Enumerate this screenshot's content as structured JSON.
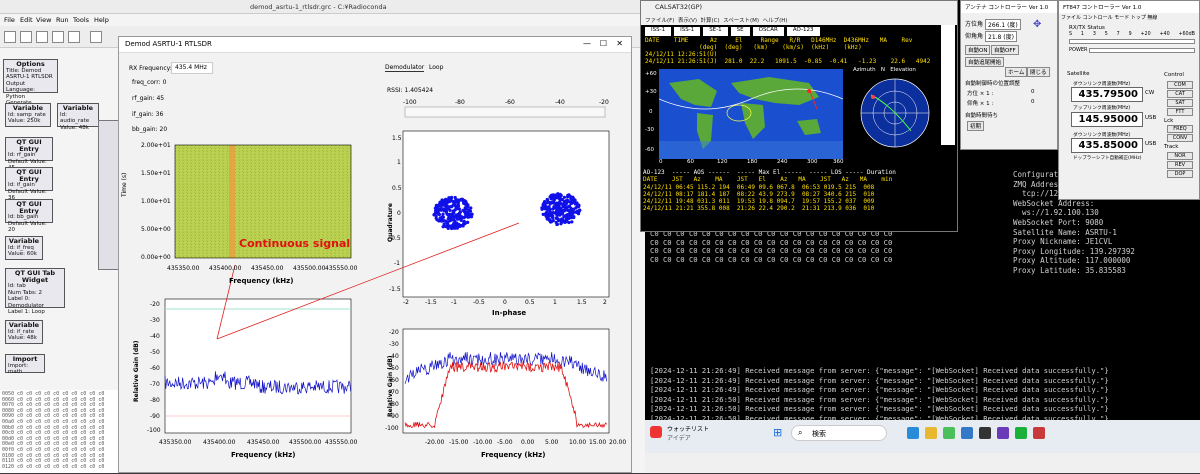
{
  "grc": {
    "title": "demod_asrtu-1_rtlsdr.grc - C:¥Radioconda",
    "menu": [
      "File",
      "Edit",
      "View",
      "Run",
      "Tools",
      "Help"
    ],
    "blocks": {
      "options": {
        "title": "Options",
        "lines": [
          "Title: Demod ASRTU-1 RTLSDR",
          "Output Language: Python",
          "Generate Options: QT GUI"
        ]
      },
      "var_samp": {
        "title": "Variable",
        "lines": [
          "Id: samp_rate",
          "Value: 250k"
        ]
      },
      "var_audio": {
        "title": "Variable",
        "lines": [
          "Id: audio_rate",
          "Value: 48k"
        ]
      },
      "rf_gain": {
        "title": "QT GUI Entry",
        "lines": [
          "Id: rf_gain",
          "Default Value: 45"
        ]
      },
      "if_gain": {
        "title": "QT GUI Entry",
        "lines": [
          "Id: if_gain",
          "Default Value: 36"
        ]
      },
      "bb_gain": {
        "title": "QT GUI Entry",
        "lines": [
          "Id: bb_gain",
          "Default Value: 20"
        ]
      },
      "var_freq": {
        "title": "Variable",
        "lines": [
          "Id: if_freq",
          "Value: 60k"
        ]
      },
      "tab_widget": {
        "title": "QT GUI Tab Widget",
        "lines": [
          "Id: tab",
          "Num Tabs: 2",
          "Label 0: Demodulator",
          "Label 1: Loop"
        ]
      },
      "var_rate": {
        "title": "Variable",
        "lines": [
          "Id: if_rate",
          "Value: 48k"
        ]
      },
      "import": {
        "title": "Import",
        "lines": [
          "Import: math"
        ]
      }
    },
    "console_lines": [
      "0050 c0 c0 c0 c0 c0 c0 c0 c0 c0 c0",
      "0060 c0 c0 c0 c0 c0 c0 c0 c0 c0 c0",
      "0070 c0 c0 c0 c0 c0 c0 c0 c0 c0 c0",
      "0080 c0 c0 c0 c0 c0 c0 c0 c0 c0 c0",
      "0090 c0 c0 c0 c0 c0 c0 c0 c0 c0 c0",
      "00a0 c0 c0 c0 c0 c0 c0 c0 c0 c0 c0",
      "00b0 c0 c0 c0 c0 c0 c0 c0 c0 c0 c0",
      "00c0 c0 c0 c0 c0 c0 c0 c0 c0 c0 c0",
      "00d0 c0 c0 c0 c0 c0 c0 c0 c0 c0 c0",
      "00e0 c0 c0 c0 c0 c0 c0 c0 c0 c0 c0",
      "00f0 c0 c0 c0 c0 c0 c0 c0 c0 c0 c0",
      "0100 c0 c0 c0 c0 c0 c0 c0 c0 c0 c0",
      "0110 c0 c0 c0 c0 c0 c0 c0 c0 c0 c0",
      "0120 c0 c0 c0 c0 c0 c0 c0 c0 c0 c0"
    ]
  },
  "demod": {
    "title": "Demod ASRTU-1 RTLSDR",
    "rx_freq_label": "RX Frequency:",
    "rx_freq_value": "435.4 MHz",
    "params": [
      "freq_corr: 0",
      "rf_gain: 45",
      "if_gain: 36",
      "bb_gain: 20"
    ],
    "tabs": [
      "Demodulator",
      "Loop"
    ],
    "rssi": "RSSI: 1.405424",
    "annotation": "Continuous signal",
    "waterfall": {
      "ylabel": "Time (s)",
      "xlabel": "Frequency (kHz)",
      "yticks": [
        "2.00e+01",
        "1.50e+01",
        "1.00e+01",
        "5.00e+00",
        "0.00e+00"
      ],
      "xticks": [
        "435350.00",
        "435400.00",
        "435450.00",
        "435500.00",
        "435550.00"
      ]
    },
    "spectrum": {
      "ylabel": "Relative Gain (dB)",
      "xlabel": "Frequency (kHz)",
      "yticks": [
        "-20",
        "-30",
        "-40",
        "-50",
        "-60",
        "-70",
        "-80",
        "-90",
        "-100"
      ],
      "xticks": [
        "435350.00",
        "435400.00",
        "435450.00",
        "435500.00",
        "435550.00"
      ]
    },
    "rssi_bar": {
      "ticks": [
        "-100",
        "-80",
        "-60",
        "-40",
        "-20"
      ]
    },
    "constellation": {
      "ylabel": "Quadrature",
      "xlabel": "In-phase",
      "yticks": [
        "1.5",
        "1",
        "0.5",
        "0",
        "-0.5",
        "-1",
        "-1.5"
      ],
      "xticks": [
        "-2",
        "-1.5",
        "-1",
        "-0.5",
        "0",
        "0.5",
        "1",
        "1.5",
        "2"
      ]
    },
    "demod_spec": {
      "ylabel": "Relative Gain (dB)",
      "xlabel": "Frequency (kHz)",
      "yticks": [
        "-20",
        "-30",
        "-40",
        "-50",
        "-60",
        "-70",
        "-80",
        "-90",
        "-100"
      ],
      "xticks": [
        "-20.00",
        "-15.00",
        "-10.00",
        "-5.00",
        "0.00",
        "5.00",
        "10.00",
        "15.00",
        "20.00"
      ]
    }
  },
  "calsat": {
    "title": "CALSAT32(GP)",
    "menu": [
      "ファイル(F)",
      "表示(V)",
      "計算(C)",
      "スペースト(M)",
      "ヘルプ(H)"
    ],
    "sat_tabs": [
      "ISS-1",
      "ISS-1",
      "SE-1",
      "SE",
      "OSCAR",
      "AO-123"
    ],
    "header": "DATE    TIME      Az     El     Range   R/R   D146MHz  D436MHz   MA    Rev",
    "units": "               (deg)  (deg)   (km)    (km/s)  (kHz)    (kHz)",
    "row1": "24/12/11 12:26:51(U)",
    "row2": "24/12/11 21:26:51(J)  281.0  22.2   1091.5  -0.85  -0.41   -1.23    22.6   4942",
    "map_xticks": [
      "0",
      "60",
      "120",
      "180",
      "240",
      "300",
      "360"
    ],
    "map_yticks": [
      "+60",
      "+30",
      "0",
      "-30",
      "-60"
    ],
    "polar_label": "Azimuth   N   Elevation",
    "pass_header": "AO-123  ----- AOS ------  ----- Max El -----  ----- LOS ----- Duration",
    "pass_cols": "DATE    JST   Az    MA    JST   El    Az   MA    JST   Az   MA    min",
    "passes": [
      "24/12/11 06:45 115.2 194  06:49 09.6 067.8  06:53 019.5 215  008",
      "24/12/11 08:17 181.4 187  08:22 43.9 273.9  08:27 340.6 215  010",
      "24/12/11 19:48 031.3 011  19:53 19.8 094.7  19:57 155.2 037  009",
      "24/12/11 21:21 355.8 008  21:26 22.4 290.2  21:31 213.9 036  010"
    ]
  },
  "rotator": {
    "title": "アンテナ コントローラー Ver 1.0",
    "az_label": "方位角",
    "az_value": "266.1 (度)",
    "el_label": "仰角角",
    "el_value": "21.8 (度)",
    "auto_on": "自動ON",
    "auto_off": "自動OFF",
    "auto_track": "自動追尾開始",
    "home": "ホーム",
    "close": "閉じる",
    "pos_title": "自動制御時の位置調整",
    "az_adj": "方位 × 1 :",
    "el_adj": "仰角 × 1 :",
    "sat_title": "自動時間待ち",
    "reset": "初期",
    "adj_val": "0"
  },
  "ftdx": {
    "title": "FT847 コントローラー Ver 1.0",
    "menu": [
      "ファイル",
      "コントロール",
      "モード",
      "トップ 無線"
    ],
    "status_title": "RX/TX Status",
    "meter_ticks": [
      "S",
      "1",
      "3",
      "5",
      "7",
      "9",
      "+20",
      "+40",
      "+60dB"
    ],
    "power_label": "POWER",
    "satellite_label": "Satellite",
    "downlink_label": "ダウンリンク周波数(MHz)",
    "downlink": "435.79500",
    "uplink_label": "アップリンク周波数(MHz)",
    "uplink": "145.95000",
    "mode_cw": "CW",
    "mode_usb": "USB",
    "third_label": "ダウンリンク周波数(MHz)",
    "third": "435.85000",
    "mode_usb2": "USB",
    "doppler_label": "ドップラーシフト自動補正(MHz)",
    "control_label": "Control",
    "control_btns": [
      "COM",
      "CAT",
      "SAT",
      "FTT"
    ],
    "lock_label": "Lck",
    "lock_btns": [
      "FREQ",
      "CONV"
    ],
    "track_label": "Track",
    "track_btns": [
      "NOR",
      "REV",
      "DOP"
    ]
  },
  "terminal": {
    "hex_line": "C0 C0 C0 C0 C0 C0 C0 C0 C0 C0 C0 C0 C0 C0 C0 C0 C0 C0 C0",
    "config": [
      "Configuration:",
      "ZMQ Address:",
      "  tcp://127.0.0.1:5555",
      "WebSocket Address:",
      "  ws://1.92.100.130",
      "WebSocket Port: 9080",
      "Satellite Name: ASRTU-1",
      "Proxy Nickname: JE1CVL",
      "Proxy Longitude: 139.297392",
      "Proxy Altitude: 117.000000",
      "Proxy Latitude: 35.835583"
    ],
    "log": [
      "[2024-12-11 21:26:49] Received message from server: {\"message\": \"[WebSocket] Received data successfully.\"}",
      "[2024-12-11 21:26:49] Received message from server: {\"message\": \"[WebSocket] Received data successfully.\"}",
      "[2024-12-11 21:26:49] Received message from server: {\"message\": \"[WebSocket] Received data successfully.\"}",
      "[2024-12-11 21:26:50] Received message from server: {\"message\": \"[WebSocket] Received data successfully.\"}",
      "[2024-12-11 21:26:50] Received message from server: {\"message\": \"[WebSocket] Received data successfully.\"}",
      "[2024-12-11 21:26:50] Received message from server: {\"message\": \"[WebSocket] Received data successfully.\"}",
      "[2024-12-11 21:26:50] Received message from server: {\"message\": \"[WebSocket] Received data successfully.\"}"
    ]
  },
  "taskbar": {
    "weather": "ウォッチリスト",
    "weather_sub": "アイデア",
    "search": "検索"
  }
}
